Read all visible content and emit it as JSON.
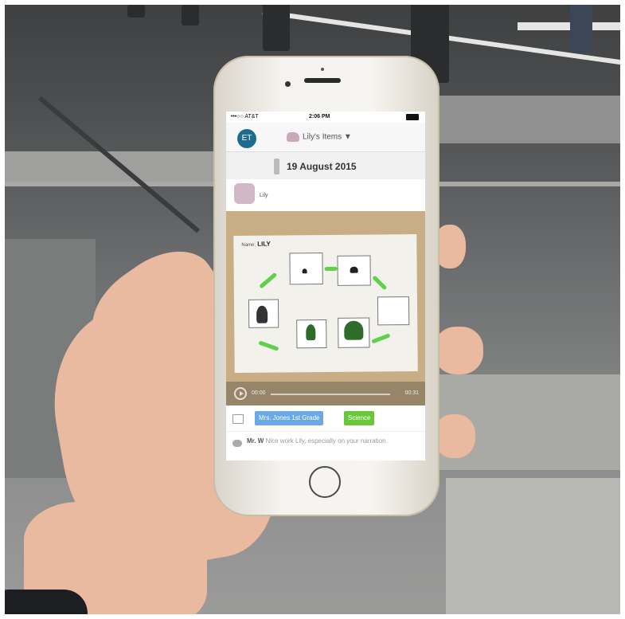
{
  "status_bar": {
    "carrier": "•••○○ AT&T",
    "time": "2:06 PM"
  },
  "nav": {
    "avatar_initials": "ET",
    "title": "Lily's Items ▼"
  },
  "entry": {
    "date": "19 August 2015",
    "student": "Lily"
  },
  "worksheet": {
    "name_label": "Name:",
    "name_value": "LILY"
  },
  "audio": {
    "elapsed": "00:00",
    "duration": "00:31"
  },
  "tags": {
    "class": "Mrs. Jones 1st Grade",
    "subject": "Science"
  },
  "comment": {
    "author": "Mr. W",
    "text": "Nice work Lily, especially on your narration."
  },
  "colors": {
    "avatar": "#1d6c8e",
    "class_tag": "#6aa8e6",
    "subject_tag": "#69c83a",
    "arrow": "#5fd04a"
  }
}
